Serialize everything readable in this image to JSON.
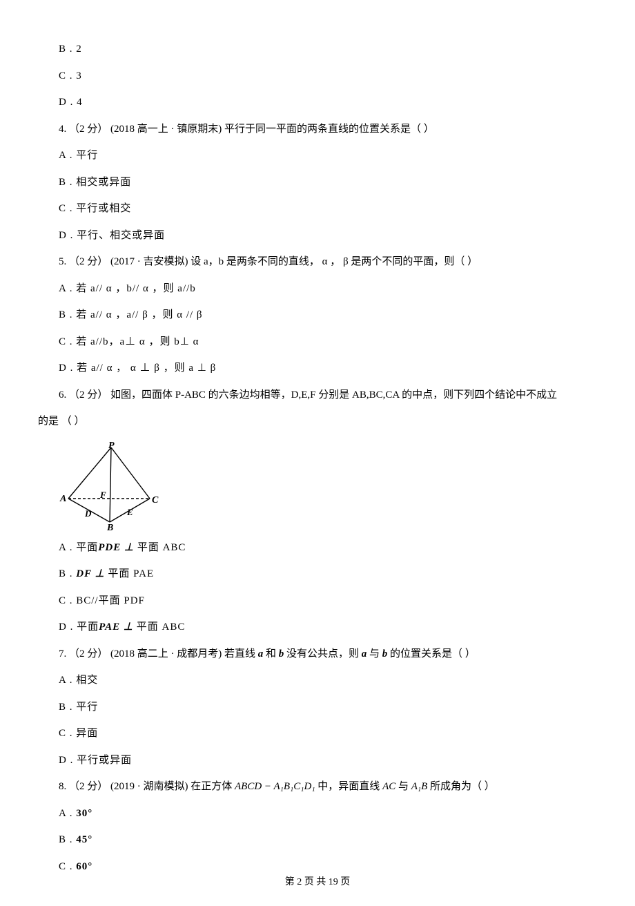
{
  "q3": {
    "optB": "B .  2",
    "optC": "C .  3",
    "optD": "D .  4"
  },
  "q4": {
    "stem_pre": "4.  （2 分）  (2018 高一上 · 镇原期末)  平行于同一平面的两条直线的位置关系是（      ）",
    "optA": "A .  平行",
    "optB": "B .  相交或异面",
    "optC": "C .  平行或相交",
    "optD": "D .  平行、相交或异面"
  },
  "q5": {
    "stem": "5.  （2 分）  (2017 · 吉安模拟)  设 a，b 是两条不同的直线，  α ，  β  是两个不同的平面，则（      ）",
    "optA": "A .  若 a// α ，b// α ，则 a//b",
    "optB": "B .  若 a// α ，a// β ，则  α // β",
    "optC": "C .  若 a//b，a⊥ α ，则 b⊥ α",
    "optD": "D .  若 a// α ， α ⊥ β ，则 a ⊥ β"
  },
  "q6": {
    "stem_l1": "6.  （2 分）   如图，四面体 P-ABC 的六条边均相等，D,E,F 分别是 AB,BC,CA 的中点，则下列四个结论中不成立",
    "stem_l2": "的是  （      ）",
    "optA_pre": "A .  平面",
    "optA_mid": "PDE ⊥ ",
    "optA_post": "平面 ABC",
    "optB_pre": "B .  ",
    "optB_mid": "DF ⊥ ",
    "optB_post": "平面 PAE",
    "optC": "C .  BC//平面 PDF",
    "optD_pre": "D .  平面",
    "optD_mid": "PAE ⊥ ",
    "optD_post": "平面 ABC",
    "fig": {
      "labels": {
        "P": "P",
        "A": "A",
        "B": "B",
        "C": "C",
        "D": "D",
        "E": "E",
        "F": "F"
      }
    }
  },
  "q7": {
    "stem_pre": "7.  （2 分）  (2018 高二上 · 成都月考)  若直线  ",
    "a": "a",
    "stem_mid1": " 和  ",
    "b": "b",
    "stem_mid2": "  没有公共点，则  ",
    "stem_mid3": " 与  ",
    "stem_post": "  的位置关系是（      ）",
    "optA": "A .  相交",
    "optB": "B .  平行",
    "optC": "C .  异面",
    "optD": "D .  平行或异面"
  },
  "q8": {
    "stem_pre": "8.  （2 分）  (2019 · 湖南模拟)  在正方体  ",
    "cube": "ABCD − A₁B₁C₁D₁",
    "stem_mid1": "  中，异面直线  ",
    "AC": "AC",
    "stem_mid2": "   与  ",
    "A1B": "A₁B",
    "stem_post": "   所成角为（      ）",
    "optA_pre": "A .  ",
    "optA_ang": "30°",
    "optB_pre": "B .  ",
    "optB_ang": "45°",
    "optC_pre": "C .  ",
    "optC_ang": "60°"
  },
  "footer": "第  2  页  共  19  页"
}
